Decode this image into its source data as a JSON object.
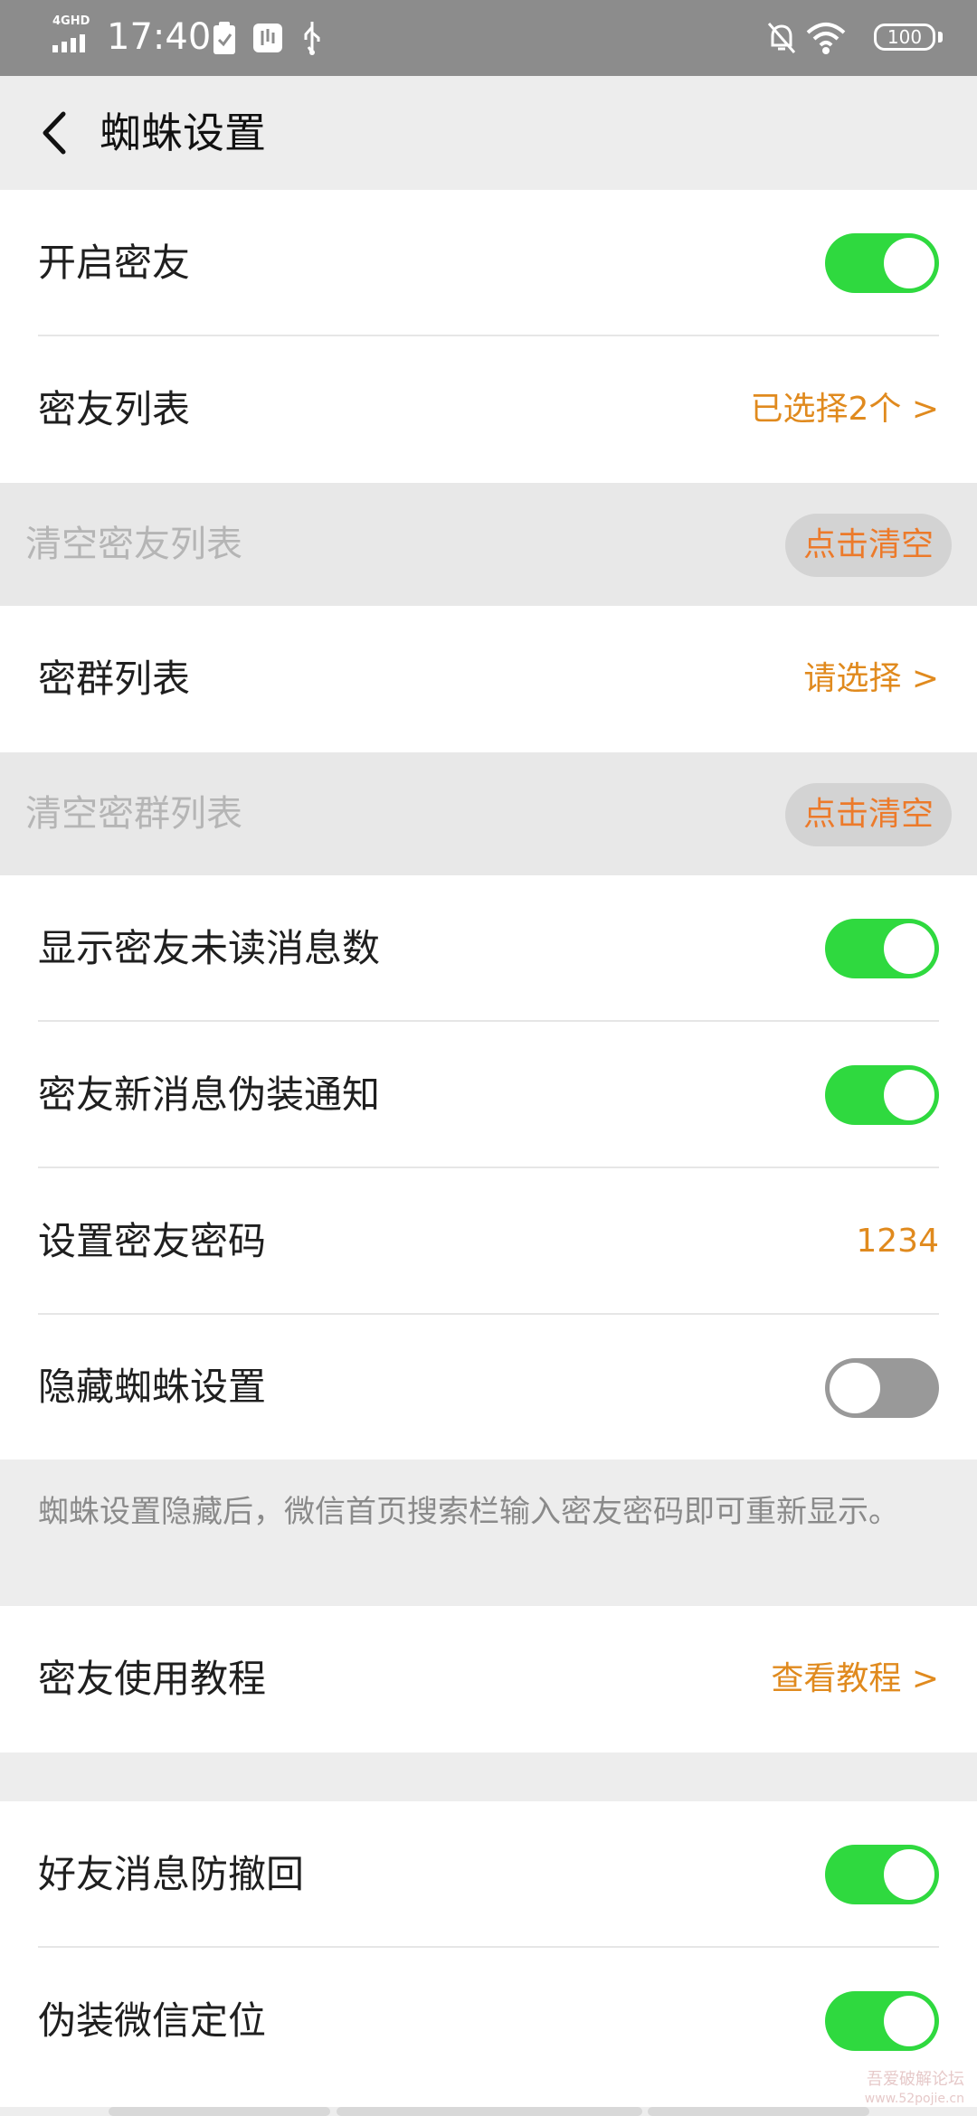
{
  "status_bar": {
    "network": "4GHD",
    "time": "17:40",
    "battery": "100"
  },
  "header": {
    "title": "蜘蛛设置"
  },
  "rows": {
    "enable_close_friends": {
      "label": "开启密友"
    },
    "close_friends_list": {
      "label": "密友列表",
      "value": "已选择2个 >"
    },
    "clear_close_friends": {
      "label": "清空密友列表",
      "button": "点击清空"
    },
    "close_groups_list": {
      "label": "密群列表",
      "value": "请选择 >"
    },
    "clear_close_groups": {
      "label": "清空密群列表",
      "button": "点击清空"
    },
    "show_unread": {
      "label": "显示密友未读消息数"
    },
    "disguise_notification": {
      "label": "密友新消息伪装通知"
    },
    "set_password": {
      "label": "设置密友密码",
      "value": "1234"
    },
    "hide_spider_settings": {
      "label": "隐藏蜘蛛设置"
    },
    "tutorial": {
      "label": "密友使用教程",
      "value": "查看教程 >"
    },
    "anti_recall": {
      "label": "好友消息防撤回"
    },
    "fake_location": {
      "label": "伪装微信定位"
    }
  },
  "hint": {
    "text": "蜘蛛设置隐藏后，微信首页搜索栏输入密友密码即可重新显示。"
  },
  "watermark": {
    "text": "吾爱破解论坛",
    "url": "www.52pojie.cn"
  },
  "colors": {
    "accent": "#e08a1e",
    "toggle_on": "#2fd93f",
    "toggle_off": "#999999",
    "clear_button_text": "#ec7a2a"
  }
}
